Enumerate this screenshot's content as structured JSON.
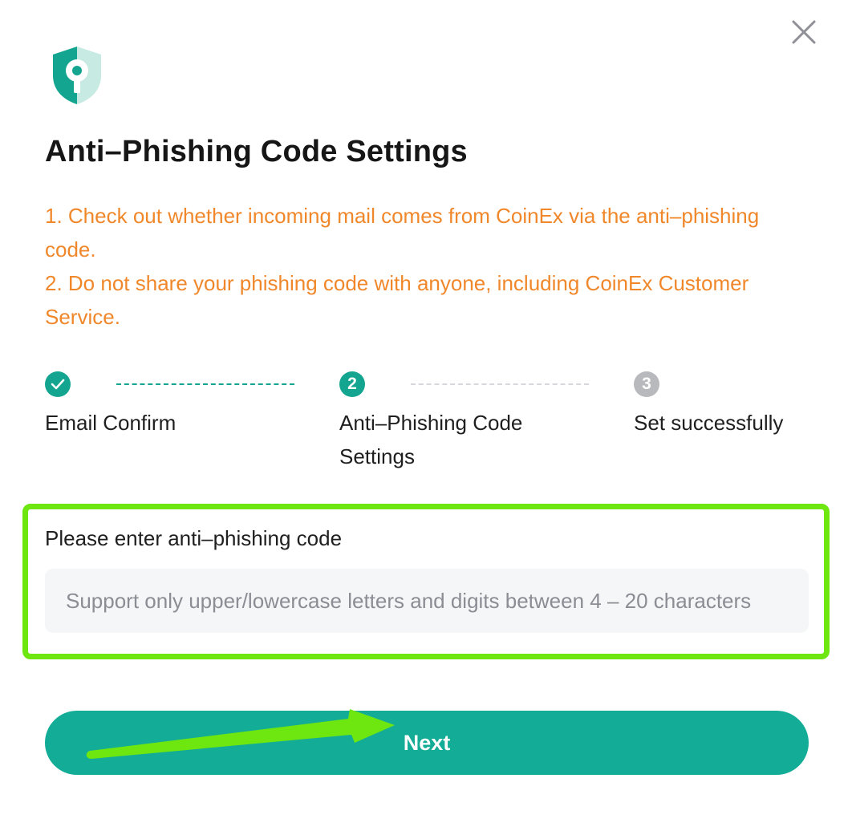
{
  "dialog": {
    "title": "Anti–Phishing Code Settings",
    "notices": [
      "1. Check out whether incoming mail comes from CoinEx via the anti–phishing code.",
      "2. Do not share your phishing code with anyone, including CoinEx Customer Service."
    ],
    "steps": [
      {
        "number": "1",
        "label": "Email Confirm",
        "state": "done"
      },
      {
        "number": "2",
        "label": "Anti–Phishing Code Settings",
        "state": "active"
      },
      {
        "number": "3",
        "label": "Set successfully",
        "state": "pending"
      }
    ],
    "field": {
      "label": "Please enter anti–phishing code",
      "placeholder": "Support only upper/lowercase letters and digits between 4 – 20 characters",
      "value": ""
    },
    "next_label": "Next",
    "icons": {
      "close": "close-icon",
      "logo": "shield-key-icon",
      "step_done": "check-icon"
    },
    "colors": {
      "accent": "#13a58f",
      "notice": "#f0882b",
      "pending": "#b8b9bd",
      "annotation": "#6ee60f"
    }
  }
}
